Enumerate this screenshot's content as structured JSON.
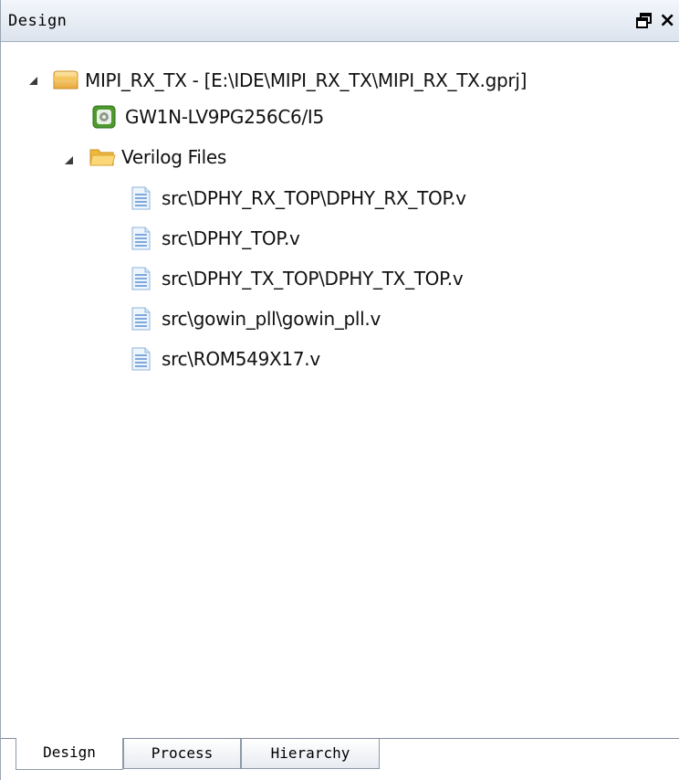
{
  "panel": {
    "title": "Design",
    "restore_icon": "restore-window-icon",
    "close_label": "×"
  },
  "tree": {
    "project": {
      "label": "MIPI_RX_TX - [E:\\IDE\\MIPI_RX_TX\\MIPI_RX_TX.gprj]",
      "icon": "project-icon",
      "expanded": true
    },
    "device": {
      "label": "GW1N-LV9PG256C6/I5",
      "icon": "chip-icon"
    },
    "folder": {
      "label": "Verilog Files",
      "icon": "folder-icon",
      "expanded": true
    },
    "files": [
      {
        "label": "src\\DPHY_RX_TOP\\DPHY_RX_TOP.v",
        "icon": "verilog-file-icon"
      },
      {
        "label": "src\\DPHY_TOP.v",
        "icon": "verilog-file-icon"
      },
      {
        "label": "src\\DPHY_TX_TOP\\DPHY_TX_TOP.v",
        "icon": "verilog-file-icon"
      },
      {
        "label": "src\\gowin_pll\\gowin_pll.v",
        "icon": "verilog-file-icon"
      },
      {
        "label": "src\\ROM549X17.v",
        "icon": "verilog-file-icon"
      }
    ]
  },
  "tabs": [
    {
      "label": "Design",
      "active": true
    },
    {
      "label": "Process",
      "active": false
    },
    {
      "label": "Hierarchy",
      "active": false
    }
  ],
  "colors": {
    "titlebar": "#dde4ee",
    "folder": "#f6c04a",
    "chip": "#5aa33a"
  }
}
